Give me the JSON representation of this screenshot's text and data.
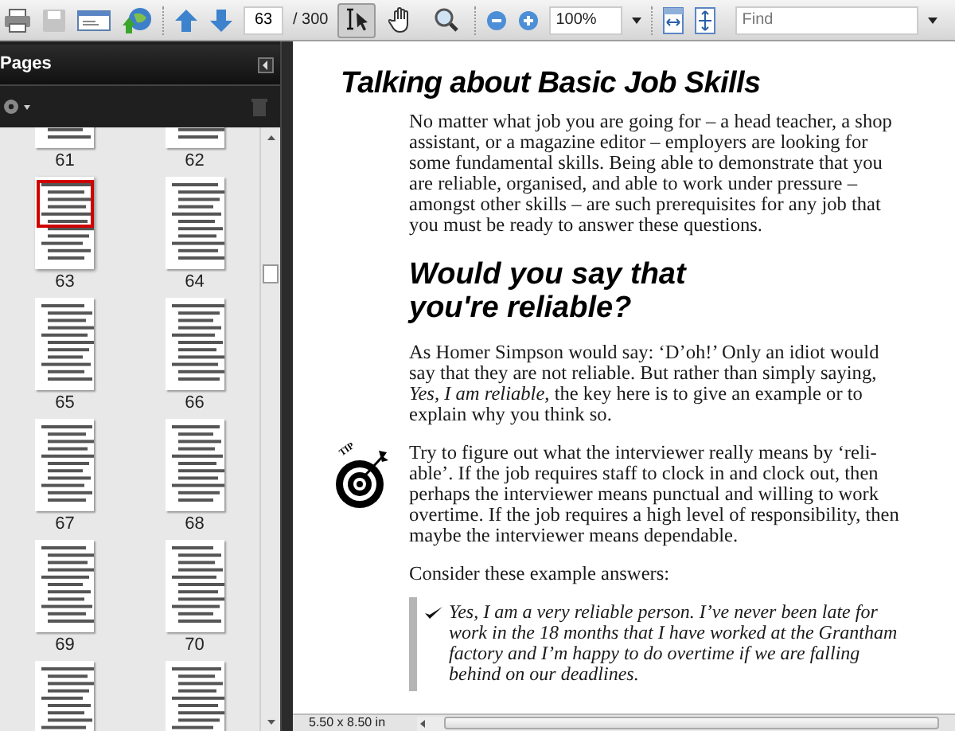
{
  "toolbar": {
    "save_button": {
      "disabled": true
    },
    "page_field": {
      "value": "63"
    },
    "page_total": "/ 300",
    "tools": [
      {
        "selected": true
      },
      {
        "selected": false
      },
      {
        "selected": false
      }
    ],
    "zoom_field": {
      "value": "100%"
    },
    "find_field": {
      "placeholder": "Find"
    }
  },
  "sidebar": {
    "title": "Pages",
    "thumbnails": [
      {
        "label": "61",
        "selected": false
      },
      {
        "label": "62",
        "selected": false
      },
      {
        "label": "63",
        "selected": true
      },
      {
        "label": "64",
        "selected": false
      },
      {
        "label": "65",
        "selected": false
      },
      {
        "label": "66",
        "selected": false
      },
      {
        "label": "67",
        "selected": false
      },
      {
        "label": "68",
        "selected": false
      },
      {
        "label": "69",
        "selected": false
      },
      {
        "label": "70",
        "selected": false
      },
      {
        "selected": false
      },
      {
        "selected": false
      }
    ]
  },
  "document": {
    "blocks": [
      {
        "kind": "title",
        "text": "Talking about Basic Job Skills"
      },
      {
        "kind": "paragraph",
        "text": "No matter what job you are going for – a head teacher, a shop assistant, or a magazine editor – employers are looking for some fundamental skills. Being able to demonstrate that you are reliable, organised, and able to work under pressure – amongst other skills – are such prerequisites for any job that you must be ready to answer these questions."
      },
      {
        "kind": "heading",
        "lines": [
          "Would you say that",
          "you're reliable?"
        ]
      },
      {
        "kind": "paragraph",
        "text": "As Homer Simpson would say: ‘D’oh!’ Only an idiot would say that they are not reliable. But rather than simply saying, *Yes, I am reliable*, the key here is to give an example or to explain why you think so."
      },
      {
        "kind": "tip",
        "icon_label": "TIP",
        "text": "Try to figure out what the interviewer really means by ‘reli-able’. If the job requires staff to clock in and clock out, then perhaps the interviewer means punctual and willing to work overtime. If the job requires a high level of responsibility, then maybe the interviewer means dependable."
      },
      {
        "kind": "paragraph",
        "text": "Consider these example answers:"
      },
      {
        "kind": "quote",
        "text": "Yes, I am a very reliable person. I’ve never been late for work in the 18 months that I have worked at the Grantham factory and I’m happy to do overtime if we are falling behind on our deadlines."
      }
    ]
  },
  "status_bar": {
    "page_size": "5.50 x 8.50 in"
  }
}
